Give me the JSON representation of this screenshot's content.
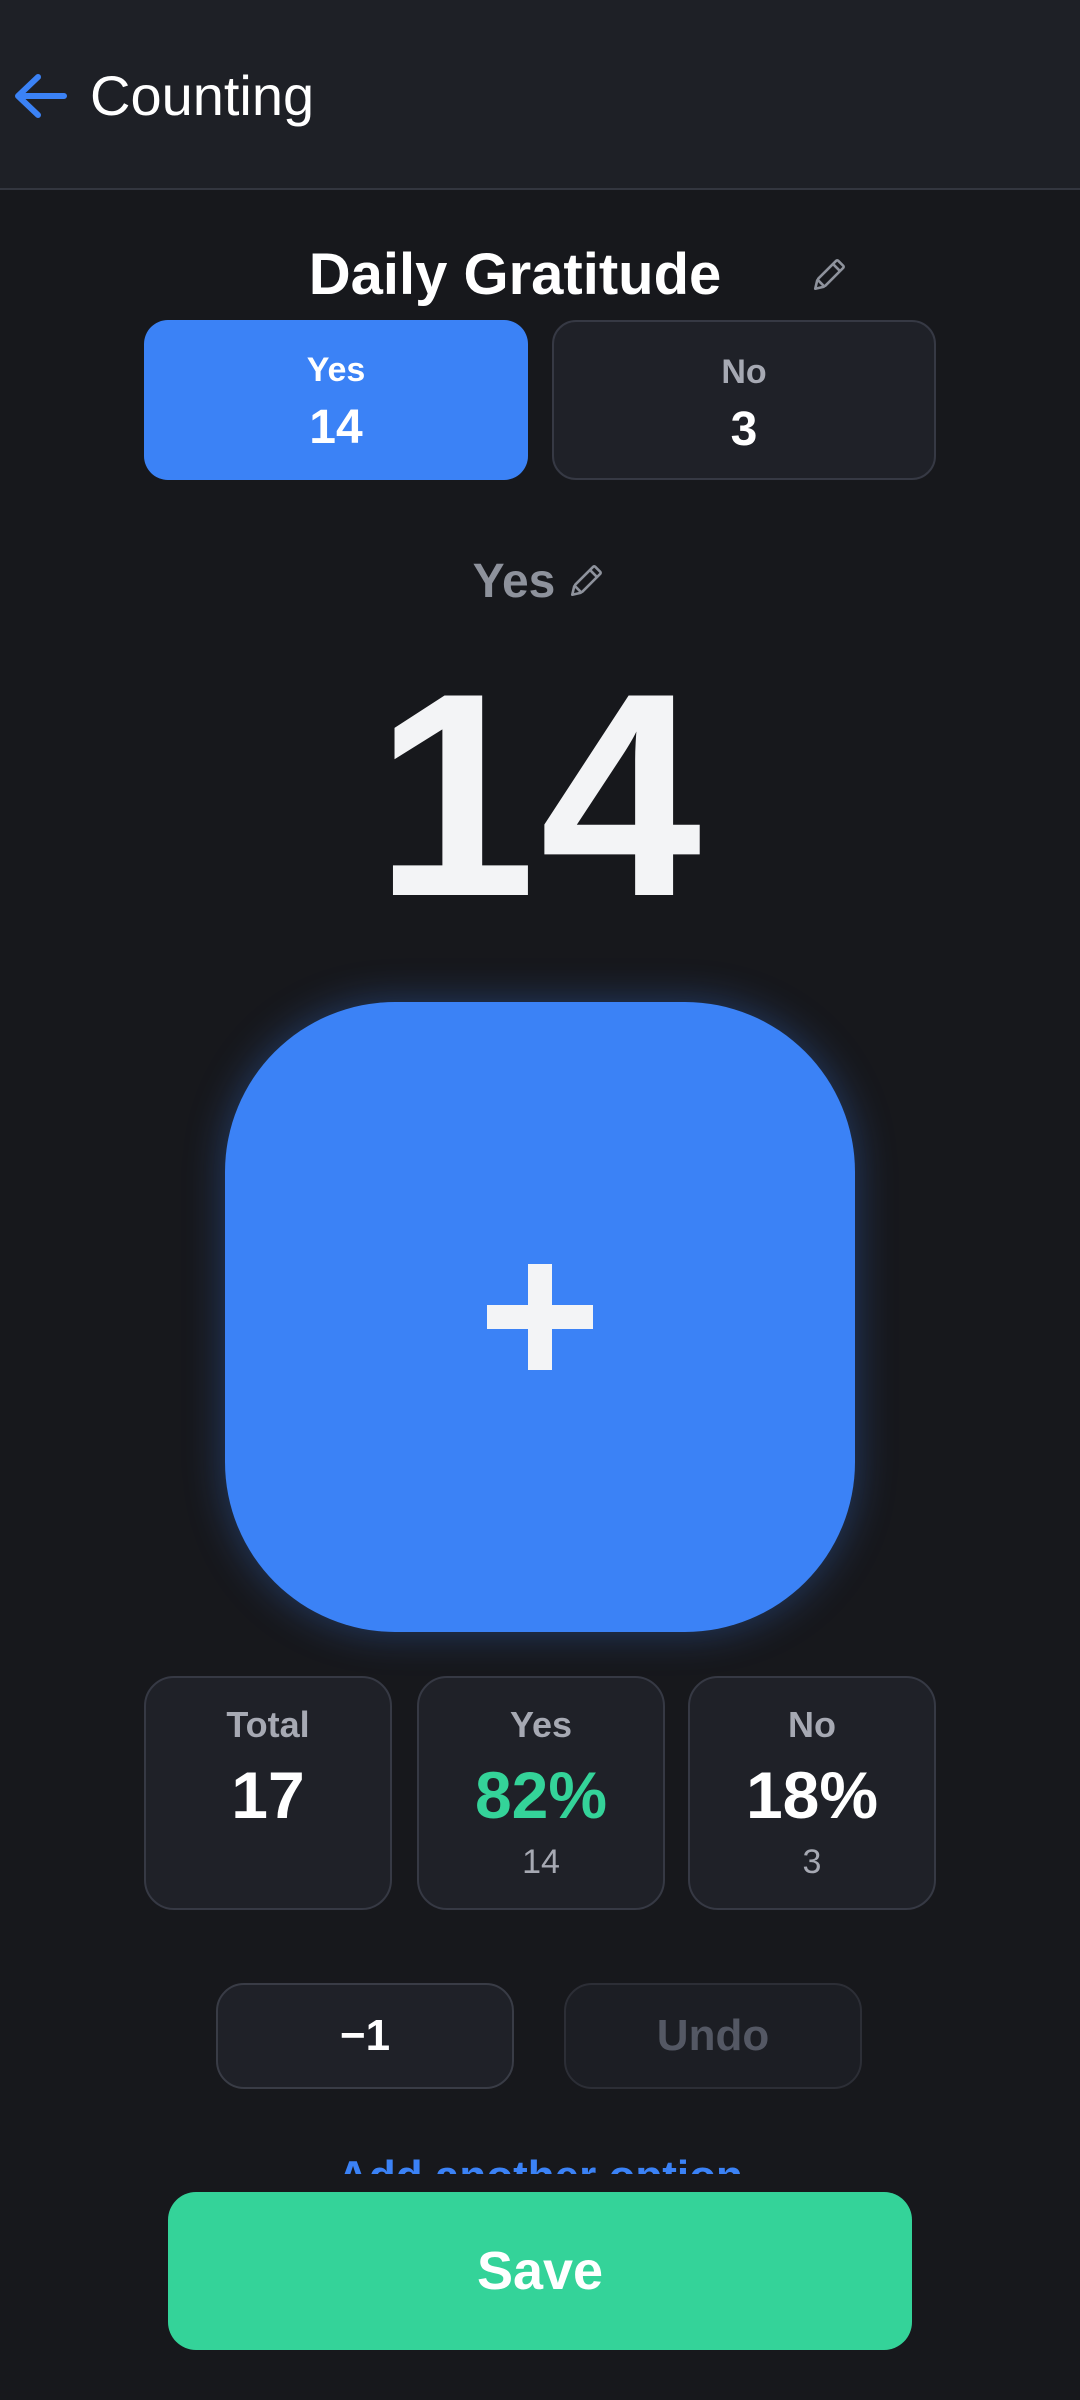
{
  "header": {
    "back_icon": "arrow-left-icon",
    "title": "Counting"
  },
  "counter": {
    "title": "Daily Gratitude",
    "edit_icon": "pencil-icon"
  },
  "options": [
    {
      "label": "Yes",
      "count": "14",
      "selected": true
    },
    {
      "label": "No",
      "count": "3",
      "selected": false
    }
  ],
  "current": {
    "label": "Yes",
    "edit_icon": "pencil-icon",
    "count": "14"
  },
  "increment": {
    "icon": "plus-icon"
  },
  "stats": {
    "total": {
      "label": "Total",
      "value": "17"
    },
    "yes": {
      "label": "Yes",
      "value": "82%",
      "sub": "14"
    },
    "no": {
      "label": "No",
      "value": "18%",
      "sub": "3"
    }
  },
  "actions": {
    "minus_label": "−1",
    "undo_label": "Undo"
  },
  "add_link": {
    "label": "Add another option"
  },
  "save": {
    "label": "Save"
  },
  "colors": {
    "background": "#17181c",
    "header": "#1e2026",
    "accent": "#3b82f6",
    "success": "#34d399",
    "card": "#1f2128",
    "muted_text": "#a6a9b3"
  }
}
